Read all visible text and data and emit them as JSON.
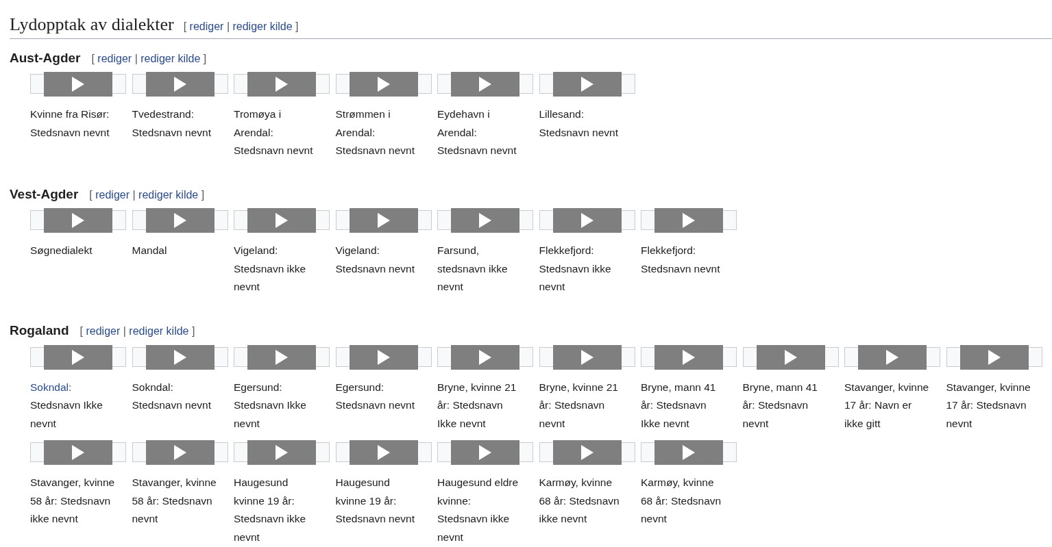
{
  "title": "Lydopptak av dialekter",
  "edit_links": {
    "open": "[",
    "links": [
      "rediger",
      "rediger kilde"
    ],
    "separator": "|",
    "close": "]"
  },
  "sections": [
    {
      "heading": "Aust-Agder",
      "edit_links": {
        "open": "[",
        "links": [
          "rediger",
          "rediger kilde"
        ],
        "separator": "|",
        "close": "]"
      },
      "rows": [
        [
          {
            "lines": [
              "Kvinne fra Risør:",
              "Stedsnavn nevnt"
            ],
            "first_line_link": false
          },
          {
            "lines": [
              "Tvedestrand:",
              "Stedsnavn nevnt"
            ],
            "first_line_link": false
          },
          {
            "lines": [
              "Tromøya i",
              "Arendal:",
              "Stedsnavn nevnt"
            ],
            "first_line_link": false
          },
          {
            "lines": [
              "Strømmen i",
              "Arendal:",
              "Stedsnavn nevnt"
            ],
            "first_line_link": false
          },
          {
            "lines": [
              "Eydehavn i",
              "Arendal:",
              "Stedsnavn nevnt"
            ],
            "first_line_link": false
          },
          {
            "lines": [
              "Lillesand:",
              "Stedsnavn nevnt"
            ],
            "first_line_link": false
          }
        ]
      ]
    },
    {
      "heading": "Vest-Agder",
      "edit_links": {
        "open": "[",
        "links": [
          "rediger",
          "rediger kilde"
        ],
        "separator": "|",
        "close": "]"
      },
      "rows": [
        [
          {
            "lines": [
              "Søgnedialekt"
            ],
            "first_line_link": false
          },
          {
            "lines": [
              "Mandal"
            ],
            "first_line_link": false
          },
          {
            "lines": [
              "Vigeland:",
              "Stedsnavn ikke",
              "nevnt"
            ],
            "first_line_link": false
          },
          {
            "lines": [
              "Vigeland:",
              "Stedsnavn nevnt"
            ],
            "first_line_link": false
          },
          {
            "lines": [
              "Farsund,",
              "stedsnavn ikke",
              "nevnt"
            ],
            "first_line_link": false
          },
          {
            "lines": [
              "Flekkefjord:",
              "Stedsnavn ikke",
              "nevnt"
            ],
            "first_line_link": false
          },
          {
            "lines": [
              "Flekkefjord:",
              "Stedsnavn nevnt"
            ],
            "first_line_link": false
          }
        ]
      ]
    },
    {
      "heading": "Rogaland",
      "edit_links": {
        "open": "[",
        "links": [
          "rediger",
          "rediger kilde"
        ],
        "separator": "|",
        "close": "]"
      },
      "rows": [
        [
          {
            "lines": [
              "Sokndal:",
              "Stedsnavn Ikke",
              "nevnt"
            ],
            "first_line_link": true
          },
          {
            "lines": [
              "Sokndal:",
              "Stedsnavn nevnt"
            ],
            "first_line_link": false
          },
          {
            "lines": [
              "Egersund:",
              "Stedsnavn Ikke",
              "nevnt"
            ],
            "first_line_link": false
          },
          {
            "lines": [
              "Egersund:",
              "Stedsnavn nevnt"
            ],
            "first_line_link": false
          },
          {
            "lines": [
              "Bryne, kvinne 21",
              "år: Stedsnavn",
              "Ikke nevnt"
            ],
            "first_line_link": false
          },
          {
            "lines": [
              "Bryne, kvinne 21",
              "år: Stedsnavn",
              "nevnt"
            ],
            "first_line_link": false
          },
          {
            "lines": [
              "Bryne, mann 41",
              "år: Stedsnavn",
              "Ikke nevnt"
            ],
            "first_line_link": false
          },
          {
            "lines": [
              "Bryne, mann 41",
              "år: Stedsnavn",
              "nevnt"
            ],
            "first_line_link": false
          },
          {
            "lines": [
              "Stavanger, kvinne",
              "17 år: Navn er",
              "ikke gitt"
            ],
            "first_line_link": false
          },
          {
            "lines": [
              "Stavanger, kvinne",
              "17 år: Stedsnavn",
              "nevnt"
            ],
            "first_line_link": false
          }
        ],
        [
          {
            "lines": [
              "Stavanger, kvinne",
              "58 år: Stedsnavn",
              "ikke nevnt"
            ],
            "first_line_link": false
          },
          {
            "lines": [
              "Stavanger, kvinne",
              "58 år: Stedsnavn",
              "nevnt"
            ],
            "first_line_link": false
          },
          {
            "lines": [
              "Haugesund",
              "kvinne 19 år:",
              "Stedsnavn ikke",
              "nevnt"
            ],
            "first_line_link": false
          },
          {
            "lines": [
              "Haugesund",
              "kvinne 19 år:",
              "Stedsnavn nevnt"
            ],
            "first_line_link": false
          },
          {
            "lines": [
              "Haugesund eldre",
              "kvinne:",
              "Stedsnavn ikke",
              "nevnt"
            ],
            "first_line_link": false
          },
          {
            "lines": [
              "Karmøy, kvinne",
              "68 år: Stedsnavn",
              "ikke nevnt"
            ],
            "first_line_link": false
          },
          {
            "lines": [
              "Karmøy, kvinne",
              "68 år: Stedsnavn",
              "nevnt"
            ],
            "first_line_link": false
          }
        ]
      ]
    }
  ]
}
